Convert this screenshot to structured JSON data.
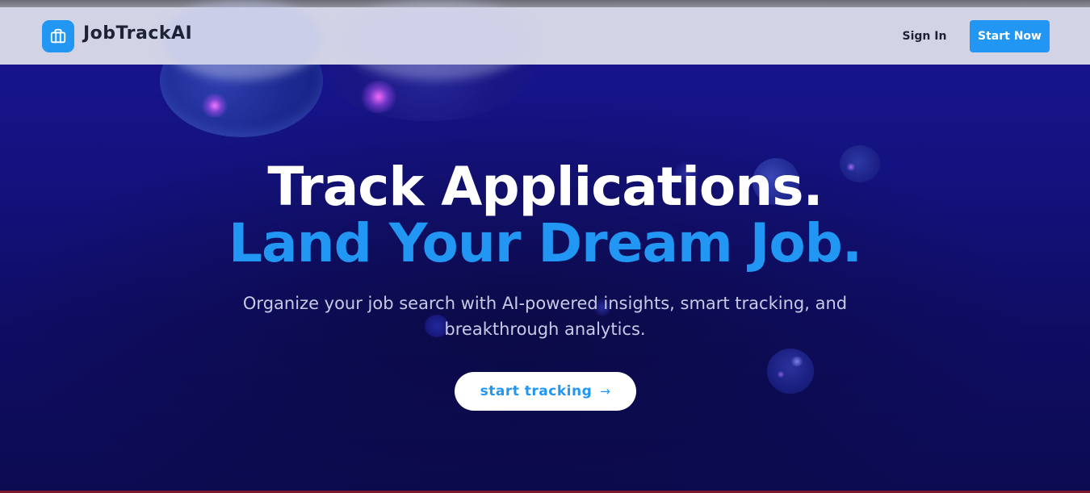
{
  "navbar": {
    "logo_icon": "briefcase-icon",
    "brand": "JobTrackAI",
    "sign_in_label": "Sign In",
    "start_now_label": "Start Now"
  },
  "hero": {
    "headline_line1": "Track Applications.",
    "headline_line2": "Land Your Dream Job.",
    "subtitle": "Organize your job search with AI-powered insights, smart tracking, and breakthrough analytics.",
    "cta_label": "start tracking",
    "cta_icon": "arrow-right-icon"
  },
  "colors": {
    "accent": "#2196f3",
    "hero_background": "#14127f",
    "navbar_background": "#dedeee",
    "headline": "#ffffff",
    "subtitle": "#c9c9e6"
  }
}
